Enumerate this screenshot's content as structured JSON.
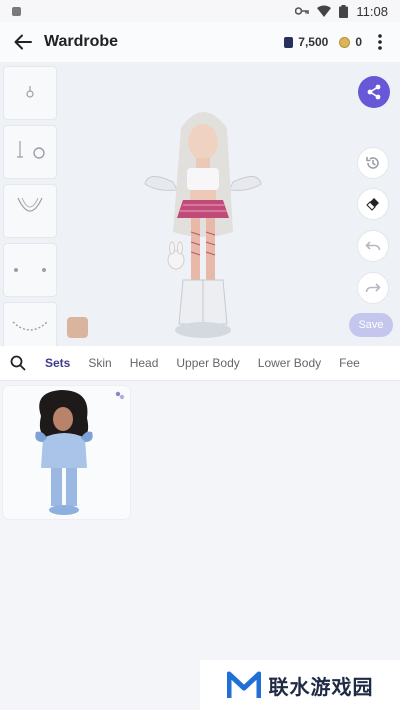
{
  "status_bar": {
    "time": "11:08"
  },
  "app_bar": {
    "title": "Wardrobe",
    "gems": "7,500",
    "coins": "0"
  },
  "stage": {
    "save_label": "Save",
    "skin_tone": "#d9b59e",
    "accent": "#6658d6"
  },
  "tabs": {
    "items": [
      "Sets",
      "Skin",
      "Head",
      "Upper Body",
      "Lower Body",
      "Fee"
    ],
    "active": "Sets"
  },
  "watermark": {
    "text": "联水游戏园"
  }
}
